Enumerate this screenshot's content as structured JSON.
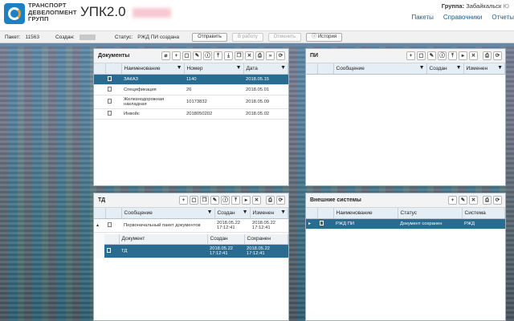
{
  "header": {
    "company": [
      "ТРАНСПОРТ",
      "ДЕВЕЛОПМЕНТ",
      "ГРУПП"
    ],
    "app_title": "УПК2.0",
    "group_label": "Группа:",
    "group_value": "Забайкальск",
    "user_short": "Ю",
    "nav": [
      "Пакеты",
      "Справочники",
      "Отчеты"
    ]
  },
  "status": {
    "packet_label": "Пакет:",
    "packet_value": "11563",
    "created_label": "Создан:",
    "status_label": "Статус:",
    "status_value": "РЖД ПИ создана",
    "buttons": {
      "send": "Отправить",
      "to_work": "В работу",
      "cancel": "Отменить",
      "history": "История"
    }
  },
  "documents": {
    "title": "Документы",
    "cols": [
      "Наименование",
      "Номер",
      "Дата"
    ],
    "rows": [
      [
        "ЗАКАЗ",
        "1140",
        "2018.05.15"
      ],
      [
        "Спецификация",
        "26",
        "2018.05.01"
      ],
      [
        "Железнодорожная накладная",
        "10173832",
        "2018.05.09"
      ],
      [
        "Инвойс",
        "2018050202",
        "2018.05.02"
      ]
    ]
  },
  "pi": {
    "title": "ПИ",
    "cols": [
      "Сообщение",
      "Создан",
      "Изменен"
    ]
  },
  "td": {
    "title": "ТД",
    "cols": [
      "Сообщение",
      "Создан",
      "Изменен"
    ],
    "row": {
      "message": "Первоначальный пакет документов",
      "created": "2018.05.22 17:12:41",
      "changed": "2018.05.22 17:12:41"
    },
    "sub_cols": [
      "Документ",
      "Создан",
      "Сохранен"
    ],
    "sub_row": {
      "doc": "ТД",
      "created": "2018.05.22 17:12:41",
      "saved": "2018.05.22 17:12:41"
    }
  },
  "ext": {
    "title": "Внешние системы",
    "cols": [
      "Наименование",
      "Статус",
      "Система"
    ],
    "row": {
      "name": "РЖД ПИ",
      "status": "Документ сохранен",
      "system": "РЖД"
    }
  },
  "icons": {
    "add": "+",
    "edit": "✎",
    "delete": "✕",
    "print": "⎙",
    "refresh": "⟳",
    "info": "ⓘ",
    "upload": "⤒",
    "download": "⤓",
    "next": "▸",
    "fwd": "»",
    "attach": "⌀",
    "page": "▢",
    "copy": "❐",
    "filter": "▼"
  }
}
